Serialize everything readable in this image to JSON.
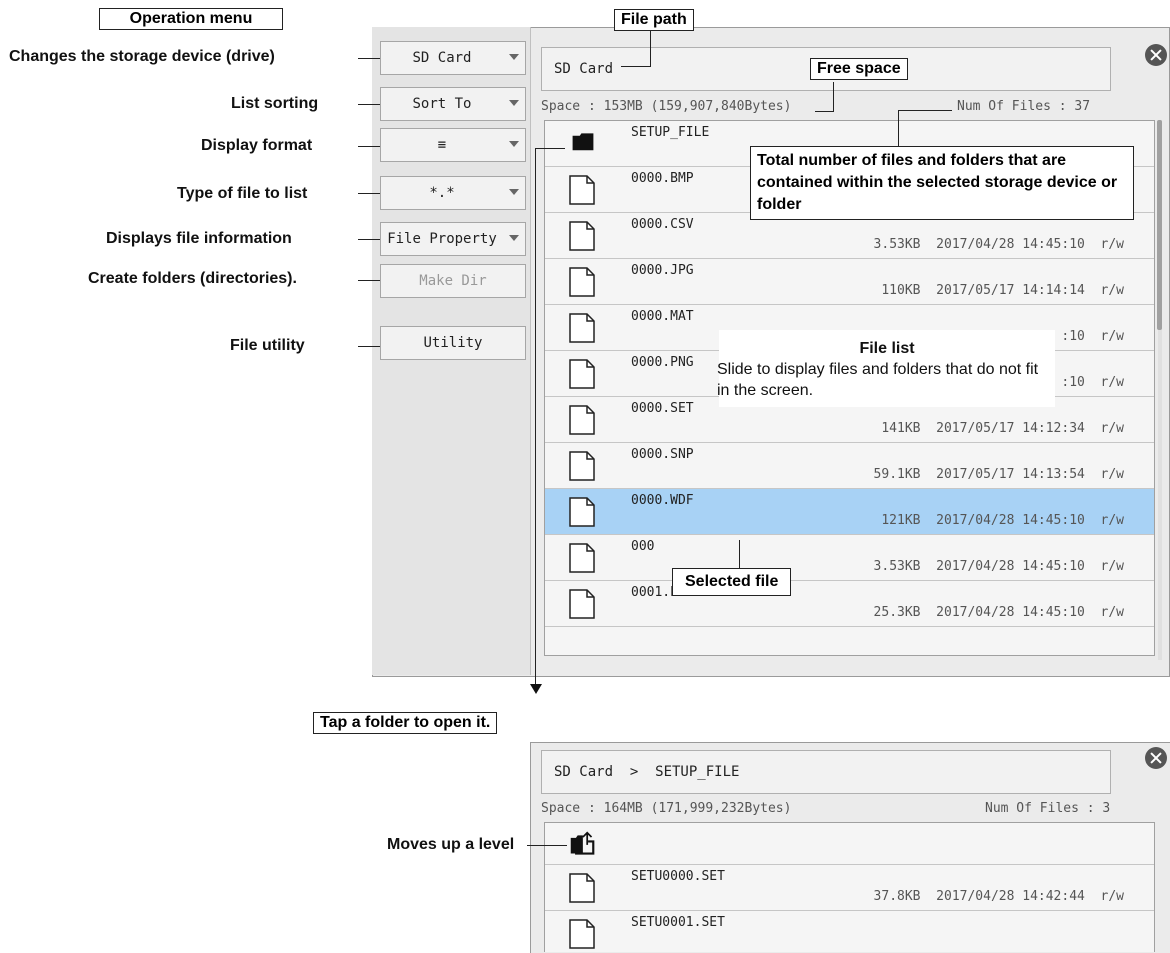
{
  "operation_menu": {
    "title": "Operation menu",
    "buttons": [
      {
        "label": "SD Card",
        "callout": "Changes the storage device (drive)"
      },
      {
        "label": "Sort To",
        "callout": "List sorting"
      },
      {
        "label": "≡",
        "callout": "Display format"
      },
      {
        "label": "*.*",
        "callout": "Type of file to list"
      },
      {
        "label": "File Property",
        "callout": "Displays file information"
      },
      {
        "label": "Make Dir",
        "callout": "Create folders (directories)."
      },
      {
        "label": "Utility",
        "callout": "File utility"
      }
    ]
  },
  "screen1": {
    "path": "SD Card",
    "space": "Space : 153MB (159,907,840Bytes)",
    "num_files": "Num Of Files : 37",
    "files": [
      {
        "name": "SETUP_FILE",
        "meta": "",
        "type": "folder"
      },
      {
        "name": "0000.BMP",
        "meta": "",
        "type": "file"
      },
      {
        "name": "0000.CSV",
        "meta": "3.53KB  2017/04/28 14:45:10  r/w",
        "type": "file"
      },
      {
        "name": "0000.JPG",
        "meta": "110KB  2017/05/17 14:14:14  r/w",
        "type": "file"
      },
      {
        "name": "0000.MAT",
        "meta": ":10  r/w",
        "type": "file"
      },
      {
        "name": "0000.PNG",
        "meta": ":10  r/w",
        "type": "file"
      },
      {
        "name": "0000.SET",
        "meta": "141KB  2017/05/17 14:12:34  r/w",
        "type": "file"
      },
      {
        "name": "0000.SNP",
        "meta": "59.1KB  2017/05/17 14:13:54  r/w",
        "type": "file"
      },
      {
        "name": "0000.WDF",
        "meta": "121KB  2017/04/28 14:45:10  r/w",
        "type": "file",
        "selected": true
      },
      {
        "name": "000",
        "meta": "3.53KB  2017/04/28 14:45:10  r/w",
        "type": "file"
      },
      {
        "name": "0001.PNG",
        "meta": "25.3KB  2017/04/28 14:45:10  r/w",
        "type": "file"
      }
    ]
  },
  "screen2": {
    "path": "SD Card  >  SETUP_FILE",
    "space": "Space : 164MB (171,999,232Bytes)",
    "num_files": "Num Of Files : 3",
    "files": [
      {
        "name": "",
        "meta": "",
        "type": "up"
      },
      {
        "name": "SETU0000.SET",
        "meta": "37.8KB  2017/04/28 14:42:44  r/w",
        "type": "file"
      },
      {
        "name": "SETU0001.SET",
        "meta": "",
        "type": "file"
      }
    ]
  },
  "annotations": {
    "file_path": "File path",
    "free_space": "Free space",
    "total_files": "Total number of files and folders that are contained within the selected storage device or folder",
    "file_list_title": "File list",
    "file_list_desc": "Slide to display files and folders that do not fit in the screen.",
    "selected_file": "Selected file",
    "tap_folder": "Tap a folder to open it.",
    "up_level": "Moves up a level"
  }
}
